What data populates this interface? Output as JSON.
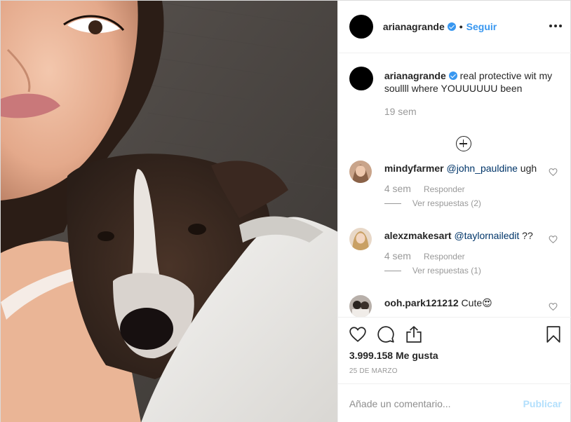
{
  "header": {
    "username": "arianagrande",
    "separator": "•",
    "follow_label": "Seguir"
  },
  "caption": {
    "username": "arianagrande",
    "text": "real protective wit my soullll where YOUUUUUU been",
    "time": "19 sem"
  },
  "comments": [
    {
      "username": "mindyfarmer",
      "mention": "@john_pauldine",
      "text": " ugh",
      "time": "4 sem",
      "reply_label": "Responder",
      "view_replies": "Ver respuestas (2)"
    },
    {
      "username": "alexzmakesart",
      "mention": "@taylornailedit",
      "text": " ??",
      "time": "4 sem",
      "reply_label": "Responder",
      "view_replies": "Ver respuestas (1)"
    },
    {
      "username": "ooh.park121212",
      "mention": "",
      "text": " Cute",
      "emoji": "😍"
    }
  ],
  "actions": {
    "likes": "3.999.158 Me gusta",
    "date": "25 DE MARZO"
  },
  "add_comment": {
    "placeholder": "Añade un comentario...",
    "publish_label": "Publicar"
  },
  "icons": {
    "verified": "verified-badge-icon",
    "more": "more-options-icon",
    "load_more": "plus-circle-icon",
    "like": "heart-icon",
    "comment": "comment-bubble-icon",
    "share": "share-icon",
    "save": "bookmark-icon"
  },
  "colors": {
    "link": "#3897f0",
    "publish_disabled": "#b2dffc",
    "mention": "#003569",
    "muted": "#999999"
  }
}
